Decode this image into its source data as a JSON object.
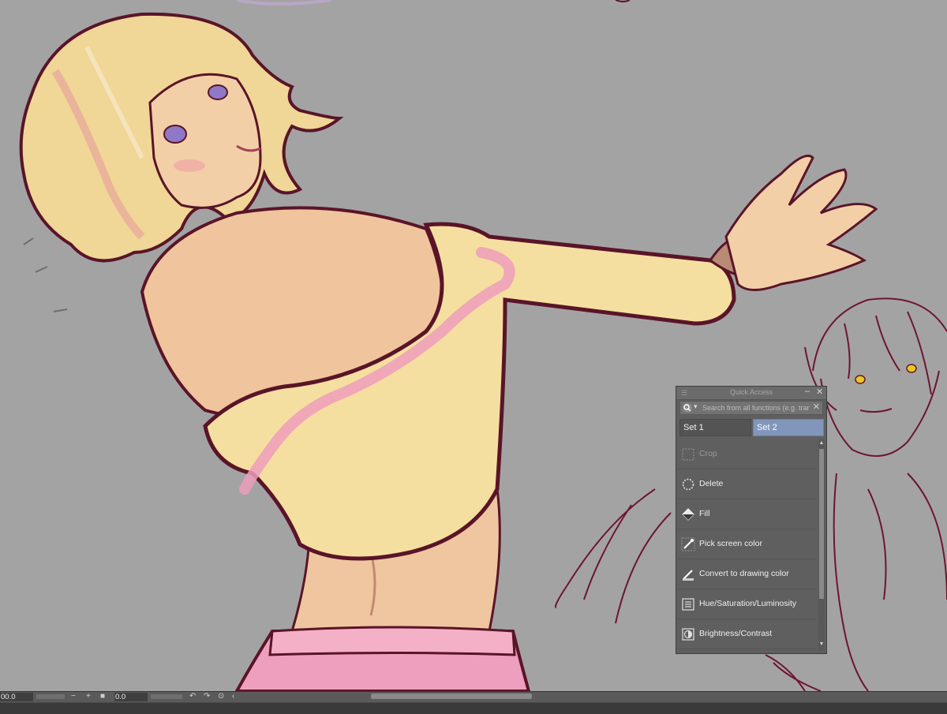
{
  "quick_access": {
    "title": "Quick Access",
    "search_placeholder": "Search from all functions (e.g. transform",
    "tabs": [
      {
        "label": "Set 1",
        "active": false
      },
      {
        "label": "Set 2",
        "active": true
      }
    ],
    "items": [
      {
        "label": "Crop",
        "icon": "crop-icon",
        "enabled": false
      },
      {
        "label": "Delete",
        "icon": "delete-icon",
        "enabled": true
      },
      {
        "label": "Fill",
        "icon": "fill-icon",
        "enabled": true
      },
      {
        "label": "Pick screen color",
        "icon": "eyedropper-icon",
        "enabled": true
      },
      {
        "label": "Convert to drawing color",
        "icon": "convert-color-icon",
        "enabled": true
      },
      {
        "label": "Hue/Saturation/Luminosity",
        "icon": "hue-saturation-icon",
        "enabled": true
      },
      {
        "label": "Brightness/Contrast",
        "icon": "brightness-contrast-icon",
        "enabled": true
      }
    ]
  },
  "statusbar": {
    "zoom_value": "00.0",
    "rotation_value": "0.0"
  },
  "colors": {
    "canvas_background": "#a3a3a3",
    "panel_background": "#5f5f5f",
    "active_tab": "#8196bb",
    "line_art": "#5a1428",
    "sketch_lines": "#6e1530"
  }
}
